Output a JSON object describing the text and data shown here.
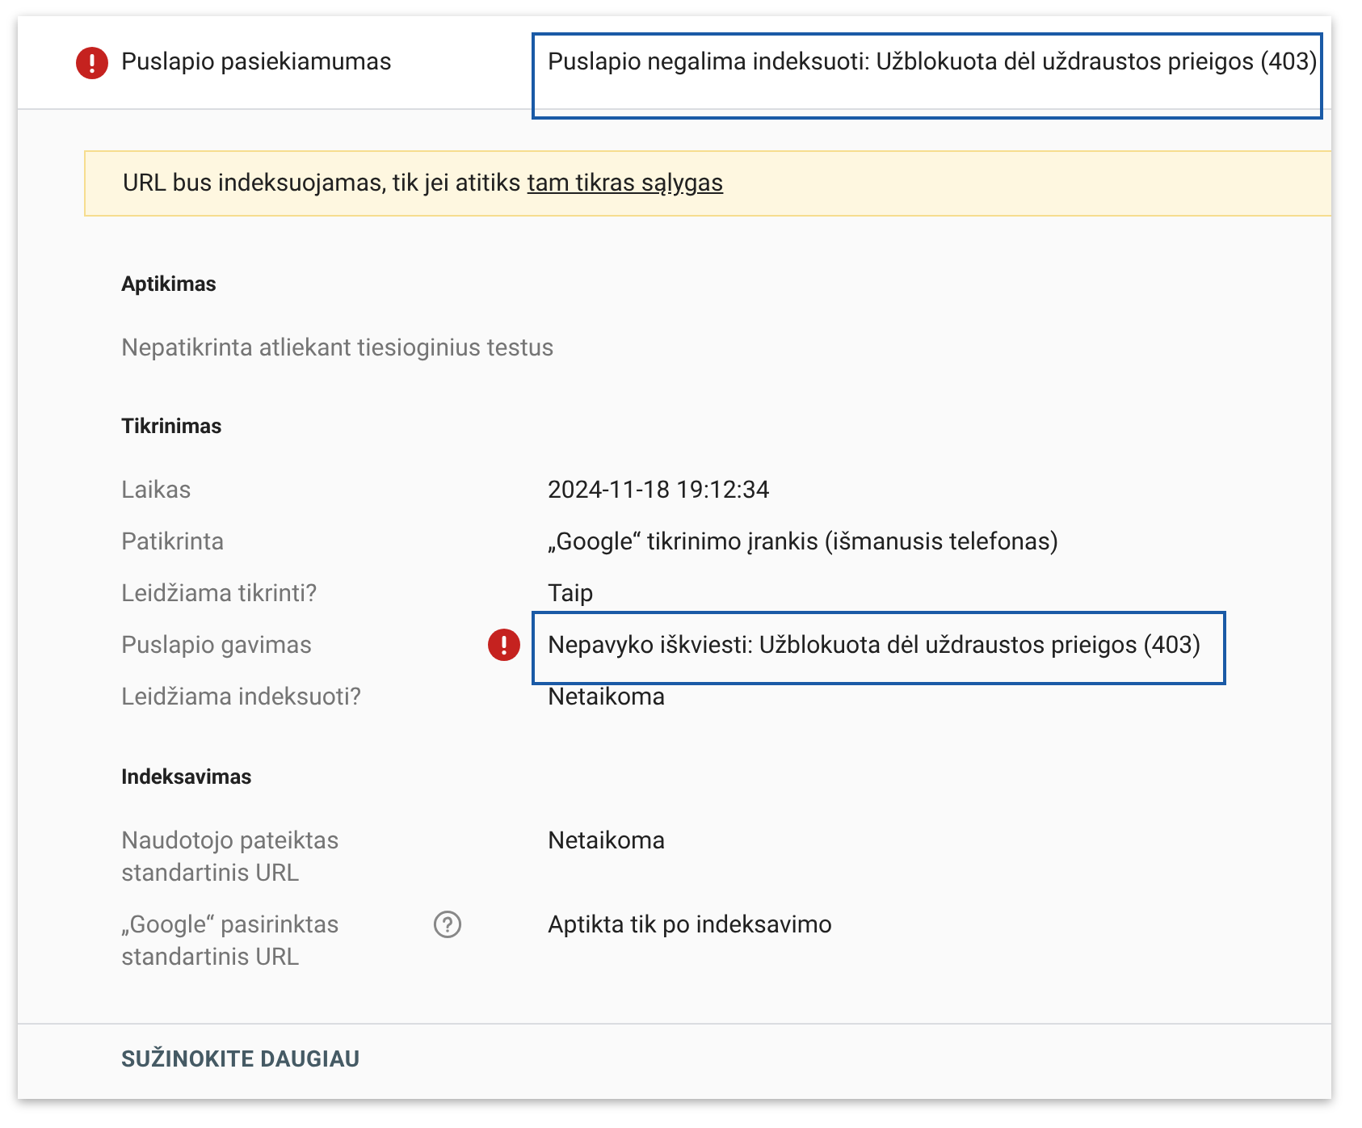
{
  "header": {
    "kind": "error",
    "label": "Puslapio pasiekiamumas",
    "value": "Puslapio negalima indeksuoti: Užblokuota dėl uždraustos prieigos (403)",
    "highlighted": true
  },
  "banner": {
    "text": "URL bus indeksuojamas, tik jei atitiks",
    "link": "tam tikras sąlygas"
  },
  "sections": [
    {
      "title": "Aptikimas",
      "note": "Nepatikrinta atliekant tiesioginius testus"
    },
    {
      "title": "Tikrinimas",
      "rows": [
        {
          "kind": "plain",
          "label": "Laikas",
          "value": "2024-11-18 19:12:34",
          "highlighted": false
        },
        {
          "kind": "plain",
          "label": "Patikrinta",
          "value": "„Google“ tikrinimo įrankis (išmanusis telefonas)",
          "highlighted": false
        },
        {
          "kind": "plain",
          "label": "Leidžiama tikrinti?",
          "value": "Taip",
          "highlighted": false
        },
        {
          "kind": "error",
          "label": "Puslapio gavimas",
          "value": "Nepavyko iškviesti: Užblokuota dėl uždraustos prieigos (403)",
          "highlighted": true
        },
        {
          "kind": "plain",
          "label": "Leidžiama indeksuoti?",
          "value": "Netaikoma",
          "highlighted": false
        }
      ]
    },
    {
      "title": "Indeksavimas",
      "rows": [
        {
          "kind": "plain",
          "label": "Naudotojo pateiktas standartinis URL",
          "value": "Netaikoma",
          "highlighted": false
        },
        {
          "kind": "help",
          "label": "„Google“ pasirinktas standartinis URL",
          "value": "Aptikta tik po indeksavimo",
          "highlighted": false
        }
      ]
    }
  ],
  "footer_link": "SUŽINOKITE DAUGIAU"
}
